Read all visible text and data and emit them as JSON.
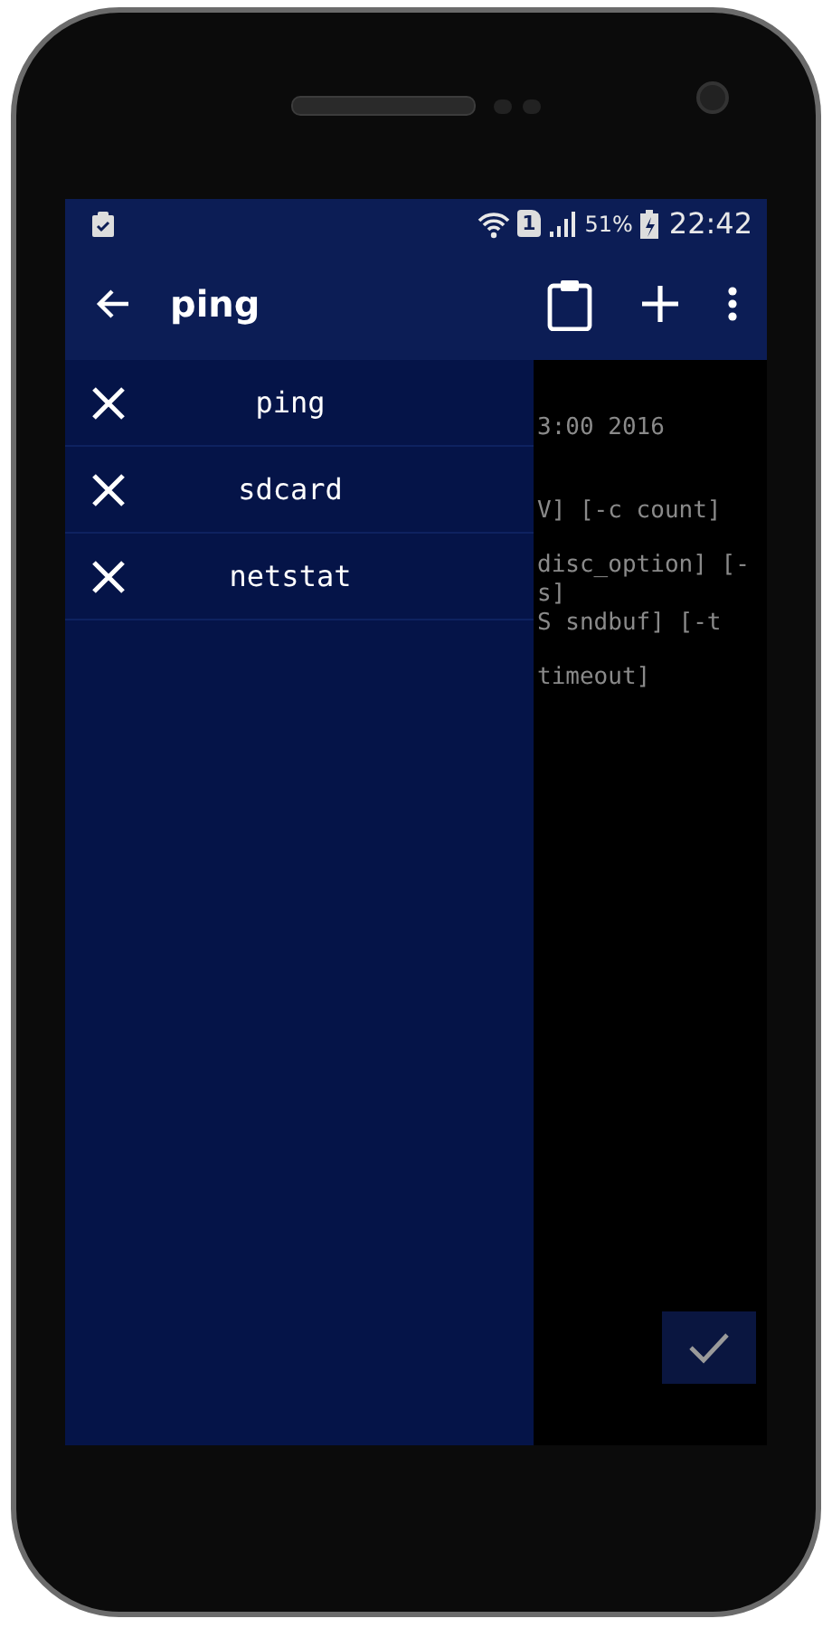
{
  "status_bar": {
    "sim_slot": "1",
    "battery": "51%",
    "time": "22:42"
  },
  "toolbar": {
    "title": "ping"
  },
  "drawer": {
    "items": [
      {
        "label": "ping"
      },
      {
        "label": "sdcard"
      },
      {
        "label": "netstat"
      }
    ]
  },
  "terminal": {
    "lines": [
      "3:00 2016",
      "V] [-c count]",
      "disc_option] [-",
      "s]",
      "S sndbuf] [-t",
      "timeout]"
    ]
  }
}
